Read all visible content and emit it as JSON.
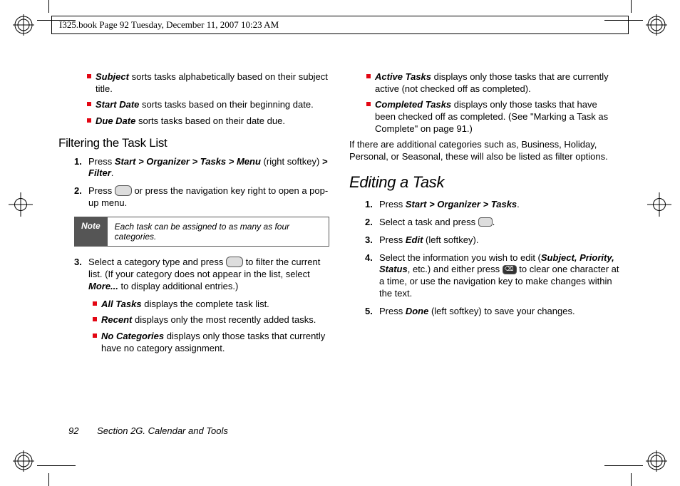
{
  "header_line": "I325.book  Page 92  Tuesday, December 11, 2007  10:23 AM",
  "left": {
    "sort_subject_term": "Subject",
    "sort_subject_rest": " sorts tasks alphabetically based on their subject title.",
    "sort_start_term": "Start Date",
    "sort_start_rest": " sorts tasks based on their beginning date.",
    "sort_due_term": "Due Date",
    "sort_due_rest": " sorts tasks based on their date due.",
    "heading": "Filtering the Task List",
    "step1_pre": "Press ",
    "step1_path": "Start > Organizer > Tasks > Menu",
    "step1_mid": " (right softkey) ",
    "step1_filter": "> Filter",
    "step1_end": ".",
    "step2_pre": "Press ",
    "step2_post": " or press the navigation key right to open a pop-up menu.",
    "note_label": "Note",
    "note_text": "Each task can be assigned to as many as four categories.",
    "step3_pre": "Select a category type and press ",
    "step3_mid": " to filter the current list. (If your category does not appear in the list, select ",
    "step3_more": "More...",
    "step3_end": " to display additional entries.)",
    "cat_all_term": "All Tasks",
    "cat_all_rest": " displays the complete task list.",
    "cat_recent_term": "Recent",
    "cat_recent_rest": " displays only the most recently added tasks.",
    "cat_nocat_term": "No Categories",
    "cat_nocat_rest": " displays only those tasks that currently have no category assignment."
  },
  "right": {
    "cat_active_term": "Active Tasks",
    "cat_active_rest": " displays only those tasks that are currently active (not checked off as completed).",
    "cat_comp_term": "Completed Tasks",
    "cat_comp_rest": " displays only those tasks that have been checked off as completed. (See \"Marking a Task as Complete\" on page 91.)",
    "extra_para": "If there are additional categories such as, Business, Holiday, Personal, or Seasonal, these will also be listed as filter options.",
    "heading": "Editing a Task",
    "e1_pre": "Press ",
    "e1_path": "Start > Organizer > Tasks",
    "e1_end": ".",
    "e2_pre": "Select a task and press ",
    "e2_end": ".",
    "e3_pre": "Press ",
    "e3_edit": "Edit",
    "e3_end": " (left softkey).",
    "e4_pre": "Select the information you wish to edit (",
    "e4_fields": "Subject, Priority, Status",
    "e4_mid": ", etc.) and either press ",
    "e4_post": " to clear one character at a time, or use the navigation key to make changes within the text.",
    "e5_pre": "Press ",
    "e5_done": "Done",
    "e5_end": " (left softkey) to save your changes."
  },
  "footer": {
    "page": "92",
    "section": "Section 2G. Calendar and Tools"
  }
}
